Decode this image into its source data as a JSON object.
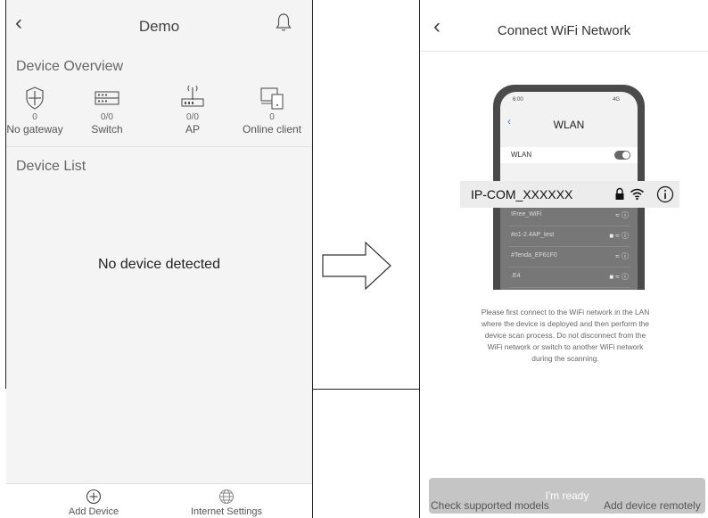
{
  "left_screen": {
    "title": "Demo",
    "overview_title": "Device Overview",
    "overview_items": [
      {
        "icon": "shield-icon",
        "count": "0",
        "label": "No gateway"
      },
      {
        "icon": "switch-icon",
        "count": "0/0",
        "label": "Switch"
      },
      {
        "icon": "router-icon",
        "count": "0/0",
        "label": "AP"
      },
      {
        "icon": "monitor-icon",
        "count": "0",
        "label": "Online client"
      }
    ],
    "list_title": "Device List",
    "empty_text": "No device detected",
    "tabs": [
      {
        "icon": "plus-circle-icon",
        "label": "Add Device"
      },
      {
        "icon": "globe-icon",
        "label": "Internet Settings"
      }
    ]
  },
  "right_screen": {
    "title": "Connect WiFi Network",
    "mock_phone": {
      "time": "6:00",
      "status": "4G",
      "header": "WLAN",
      "wlan_label": "WLAN",
      "networks": [
        "!Free_WiFi",
        "#o1-2.4AP_test",
        "#Tenda_EF61F0",
        ".E4"
      ],
      "network_locked": [
        false,
        true,
        false,
        true
      ]
    },
    "highlighted_network": "IP-COM_XXXXXX",
    "instructions": [
      "Please first connect to the WiFi network in the LAN",
      "where the device is deployed and then perform the",
      "device scan process. Do not disconnect from the",
      "WiFi network or switch to another WiFi network",
      "during the scanning."
    ],
    "ready_button": "I'm ready",
    "check_models": "Check supported models",
    "add_remote": "Add device remotely"
  },
  "colors": {
    "bg_gray": "#f4f4f4",
    "button_disabled": "#c5c5c5",
    "text_dark": "#222222"
  }
}
